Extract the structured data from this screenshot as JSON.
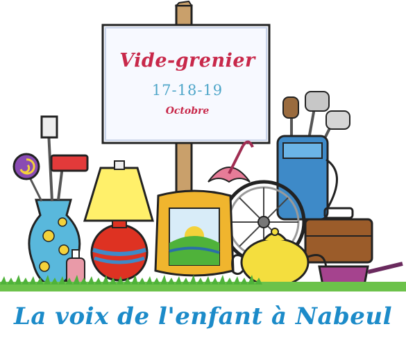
{
  "sign": {
    "title": "Vide-grenier",
    "dates": "17-18-19",
    "month": "Octobre"
  },
  "footer": {
    "tagline": "La voix de l'enfant à Nabeul"
  },
  "colors": {
    "title": "#c8284a",
    "dates": "#4fa6c9",
    "tagline": "#1c8bc9",
    "grass": "#4fb23a"
  },
  "illustration": {
    "icons": [
      "sign-board-icon",
      "blue-vase-icon",
      "lollipop-icon",
      "mallet-icon",
      "table-lamp-icon",
      "picture-frame-icon",
      "umbrella-icon",
      "wheel-icon",
      "teapot-icon",
      "golf-bag-icon",
      "suitcase-icon",
      "saucepan-icon",
      "perfume-bottle-icon",
      "grass-icon"
    ]
  }
}
